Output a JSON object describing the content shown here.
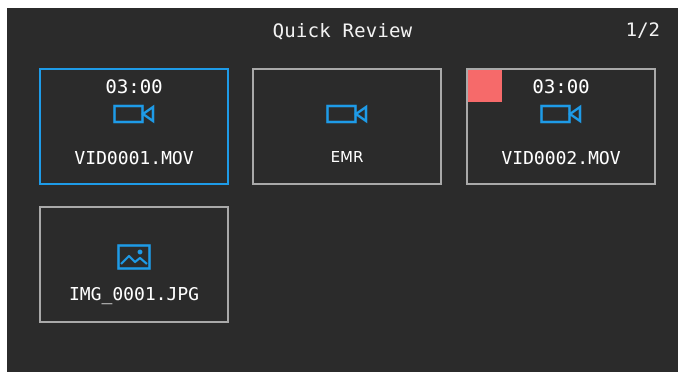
{
  "header": {
    "title": "Quick Review",
    "page_indicator": "1/2"
  },
  "colors": {
    "background": "#2b2b2b",
    "tile_border": "#a9a9a9",
    "selected_border": "#1e9be8",
    "icon": "#1e9be8",
    "badge": "#f66a6a"
  },
  "files": [
    {
      "duration": "03:00",
      "name": "VID0001.MOV",
      "icon": "video-camera-icon",
      "selected": true
    },
    {
      "duration": "",
      "name": "EMR",
      "icon": "video-camera-icon",
      "selected": false
    },
    {
      "duration": "03:00",
      "name": "VID0002.MOV",
      "icon": "video-camera-icon",
      "selected": false,
      "badge": "red-square"
    },
    {
      "duration": "",
      "name": "IMG_0001.JPG",
      "icon": "image-icon",
      "selected": false
    }
  ]
}
